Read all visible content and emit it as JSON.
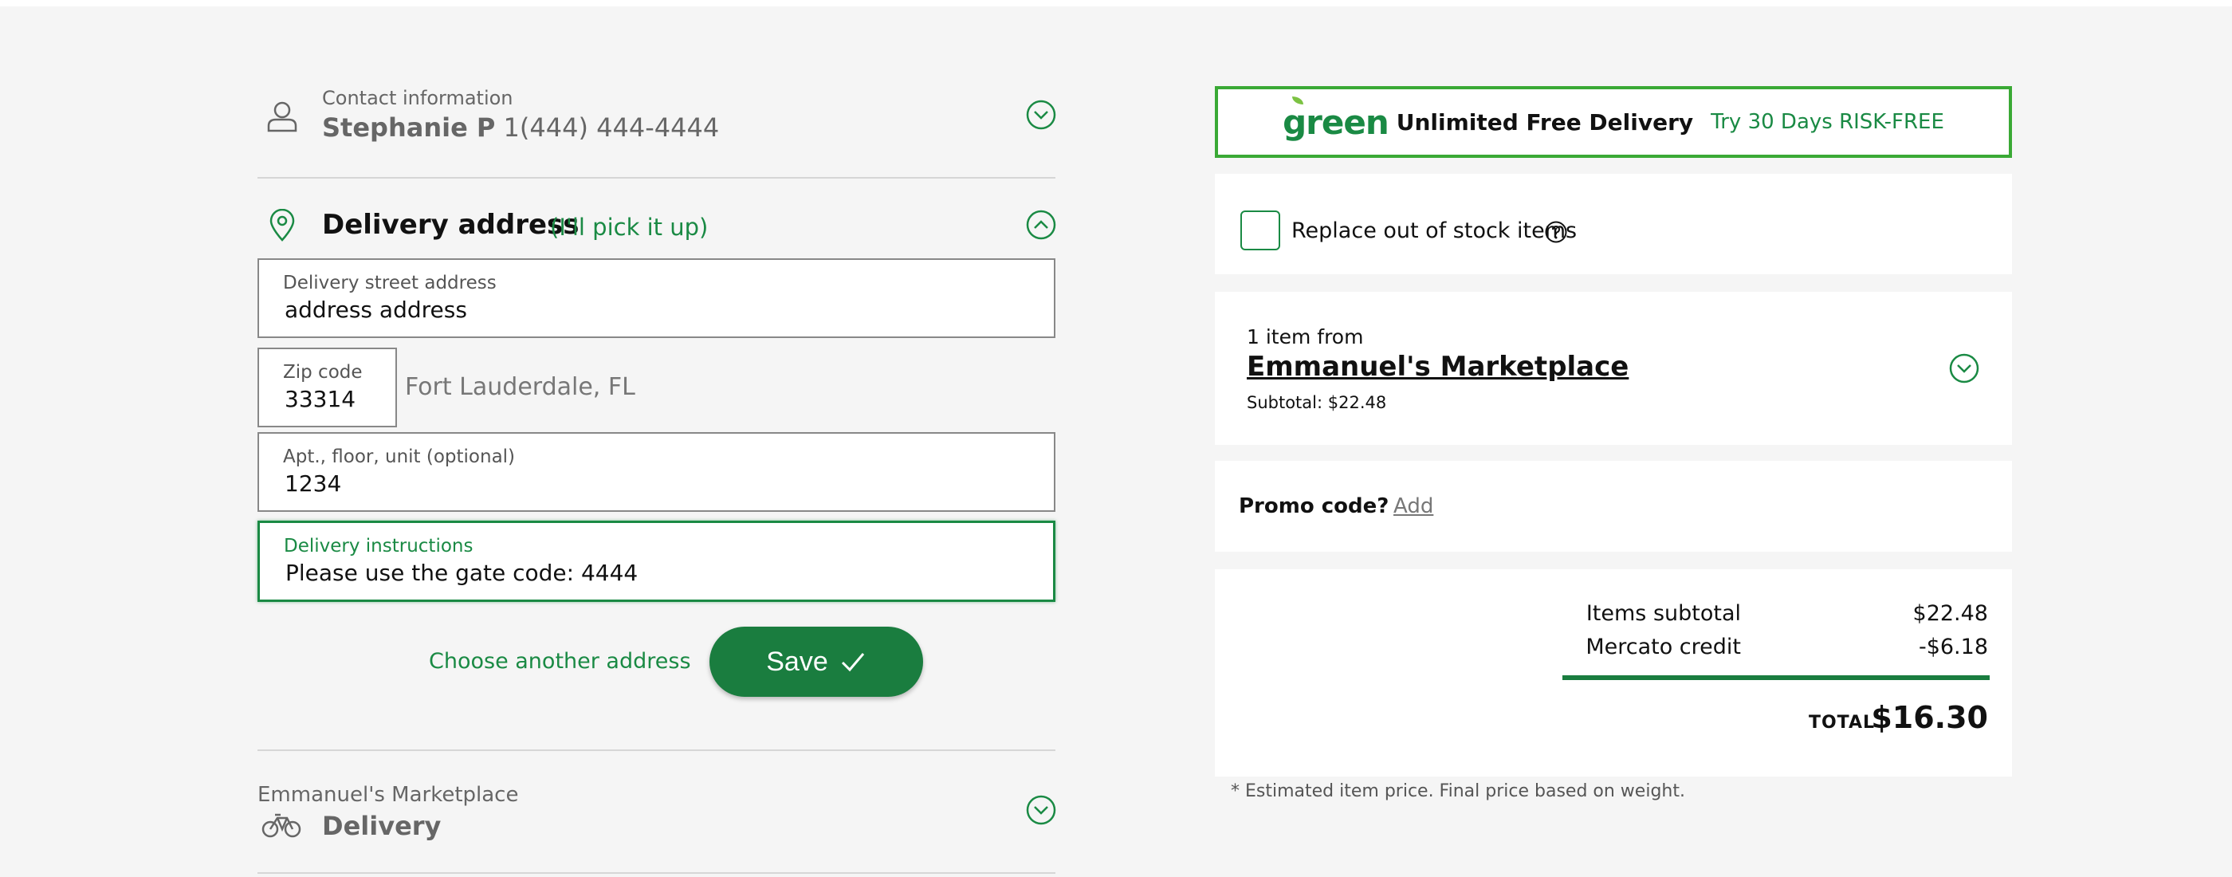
{
  "contact": {
    "label": "Contact information",
    "name": "Stephanie P",
    "phone": "1(444) 444-4444"
  },
  "delivery": {
    "title": "Delivery address",
    "pickup_link": "(I'll pick it up)",
    "street": {
      "label": "Delivery street address",
      "value": "address address"
    },
    "zip": {
      "label": "Zip code",
      "value": "33314"
    },
    "city": "Fort Lauderdale, FL",
    "apt": {
      "label": "Apt., floor, unit (optional)",
      "value": "1234"
    },
    "instructions": {
      "label": "Delivery instructions",
      "value": "Please use the gate code: 4444"
    },
    "choose_another": "Choose another address",
    "save_label": "Save"
  },
  "store_section": {
    "store": "Emmanuel's Marketplace",
    "method": "Delivery"
  },
  "banner": {
    "logo": "green",
    "title": "Unlimited Free Delivery",
    "offer": "Try 30 Days RISK-FREE"
  },
  "replace": {
    "label": "Replace out of stock items",
    "checked": false
  },
  "cart": {
    "count_text": "1 item from",
    "store": "Emmanuel's Marketplace",
    "subtotal": "Subtotal: $22.48"
  },
  "promo": {
    "label": "Promo code?",
    "add": "Add"
  },
  "summary": {
    "items_subtotal_label": "Items subtotal",
    "items_subtotal_value": "$22.48",
    "credit_label": "Mercato credit",
    "credit_value": "-$6.18",
    "total_label": "TOTAL",
    "total_value": "$16.30"
  },
  "footnote": "* Estimated item price. Final price based on weight.",
  "colors": {
    "accent": "#1a8a44",
    "button": "#1a7d3f",
    "banner_border": "#3aa935"
  }
}
